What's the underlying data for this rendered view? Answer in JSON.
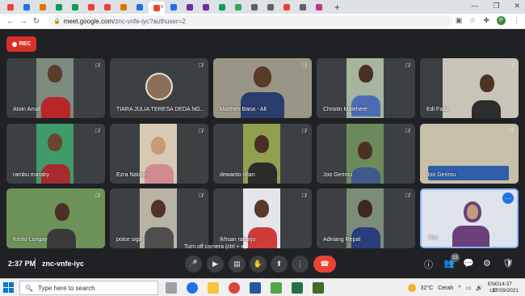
{
  "browser": {
    "tab_favicon_colors": [
      "#ea4335",
      "#1a73e8",
      "#e37400",
      "#0f9d58",
      "#0f9d58",
      "#ea4335",
      "#ea4335",
      "#e37400",
      "#1a73e8",
      "#ea4335",
      "#1a73e8",
      "#6b2fa3",
      "#6b2fa3",
      "#0f9d58",
      "#34a853",
      "#5f6368",
      "#5f6368",
      "#ea4335",
      "#5f6368",
      "#c13584"
    ],
    "url_host": "meet.google.com",
    "url_path": "/znc-vnfe-iyc?authuser=2",
    "profile_initial": "P"
  },
  "meet": {
    "rec_label": "REC",
    "participants": [
      {
        "name": "Atoin Amaf"
      },
      {
        "name": "TIARA JULIA TERESA DEDA NG..."
      },
      {
        "name": "Marthen Bana - Alt"
      },
      {
        "name": "Christin Malehere"
      },
      {
        "name": "Edi Fallo"
      },
      {
        "name": "rambu maraby"
      },
      {
        "name": "Ezra Natalyn"
      },
      {
        "name": "dewanto riflan"
      },
      {
        "name": "Joo Gerimu"
      },
      {
        "name": "Joo Gerimu"
      },
      {
        "name": "Kristo Longay"
      },
      {
        "name": "polce siga"
      },
      {
        "name": "Ikhsan raharjo"
      },
      {
        "name": "Adiriang Repat"
      },
      {
        "name": "You"
      }
    ],
    "tooltip": "Turn off camera (ctrl + e)",
    "time": "2:37 PM",
    "meeting_code": "znc-vnfe-iyc",
    "participant_count": "15"
  },
  "taskbar": {
    "search_placeholder": "Type here to search",
    "temperature": "32°C",
    "weather": "Cerah",
    "lang_top": "ENG",
    "lang_bottom": "US",
    "clock_time": "14:37",
    "clock_date": "17/09/2021"
  }
}
